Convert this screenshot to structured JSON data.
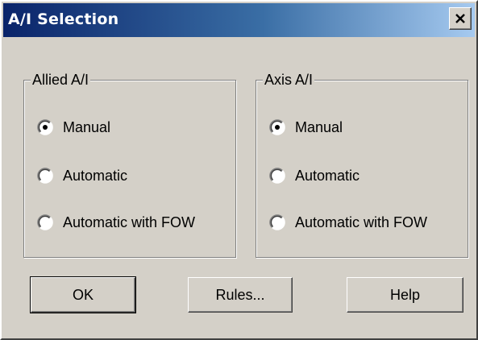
{
  "window": {
    "title": "A/I Selection",
    "close_label": "×"
  },
  "groups": {
    "allied": {
      "legend": "Allied A/I",
      "options": [
        "Manual",
        "Automatic",
        "Automatic with FOW"
      ],
      "selected": "Manual"
    },
    "axis": {
      "legend": "Axis A/I",
      "options": [
        "Manual",
        "Automatic",
        "Automatic with FOW"
      ],
      "selected": "Manual"
    }
  },
  "buttons": {
    "ok": "OK",
    "rules": "Rules...",
    "help": "Help"
  },
  "colors": {
    "face": "#d4d0c8",
    "title_start": "#0a246a",
    "title_end": "#a6caf0"
  }
}
